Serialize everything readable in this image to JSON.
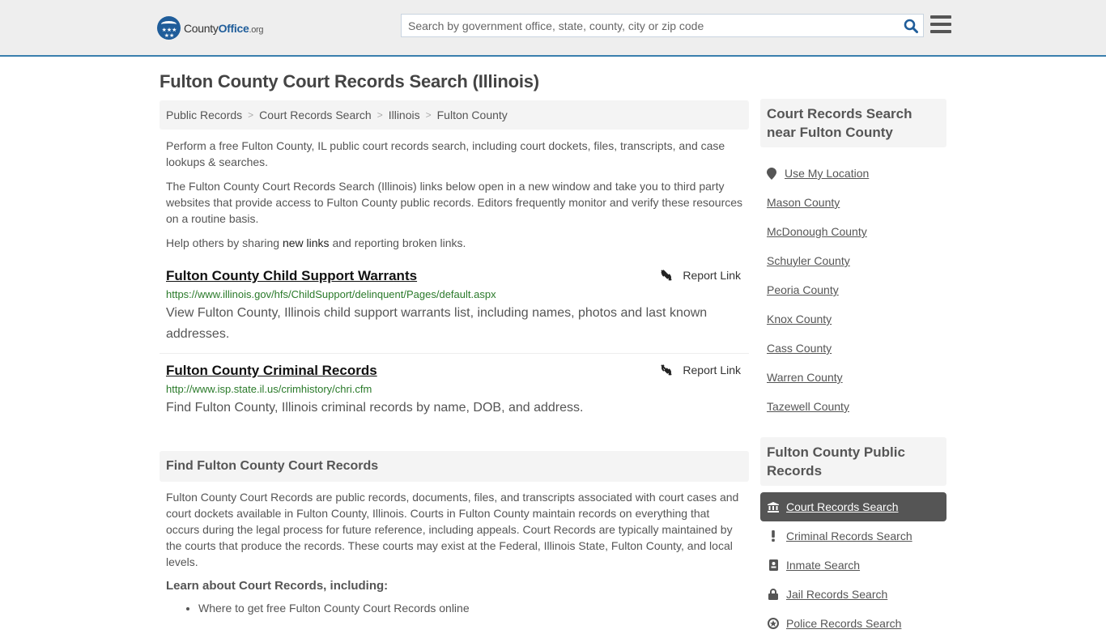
{
  "header": {
    "logo": {
      "name_part1": "County",
      "name_part2": "Office",
      "tld": ".org"
    },
    "search": {
      "placeholder": "Search by government office, state, county, city or zip code",
      "value": ""
    },
    "colors": {
      "brand": "#1f5d9a",
      "topbar_border": "#3a7fad"
    }
  },
  "page": {
    "title": "Fulton County Court Records Search (Illinois)"
  },
  "breadcrumb": [
    {
      "label": "Public Records"
    },
    {
      "label": "Court Records Search"
    },
    {
      "label": "Illinois"
    },
    {
      "label": "Fulton County"
    }
  ],
  "intro": {
    "p1": "Perform a free Fulton County, IL public court records search, including court dockets, files, transcripts, and case lookups & searches.",
    "p2": "The Fulton County Court Records Search (Illinois) links below open in a new window and take you to third party websites that provide access to Fulton County public records. Editors frequently monitor and verify these resources on a routine basis.",
    "p3_before": "Help others by sharing ",
    "p3_link": "new links",
    "p3_after": " and reporting broken links."
  },
  "links": [
    {
      "title": "Fulton County Child Support Warrants",
      "url": "https://www.illinois.gov/hfs/ChildSupport/delinquent/Pages/default.aspx",
      "description": "View Fulton County, Illinois child support warrants list, including names, photos and last known addresses.",
      "report_label": "Report Link"
    },
    {
      "title": "Fulton County Criminal Records",
      "url": "http://www.isp.state.il.us/crimhistory/chri.cfm",
      "description": "Find Fulton County, Illinois criminal records by name, DOB, and address.",
      "report_label": "Report Link"
    }
  ],
  "find_section": {
    "heading": "Find Fulton County Court Records",
    "body": "Fulton County Court Records are public records, documents, files, and transcripts associated with court cases and court dockets available in Fulton County, Illinois. Courts in Fulton County maintain records on everything that occurs during the legal process for future reference, including appeals. Court Records are typically maintained by the courts that produce the records. These courts may exist at the Federal, Illinois State, Fulton County, and local levels.",
    "learn_heading": "Learn about Court Records, including:",
    "learn_items": [
      "Where to get free Fulton County Court Records online"
    ]
  },
  "sidebar": {
    "near_heading": "Court Records Search near Fulton County",
    "use_location": "Use My Location",
    "near_items": [
      "Mason County",
      "McDonough County",
      "Schuyler County",
      "Peoria County",
      "Knox County",
      "Cass County",
      "Warren County",
      "Tazewell County"
    ],
    "public_heading": "Fulton County Public Records",
    "public_items": [
      {
        "label": "Court Records Search",
        "icon": "courthouse-icon",
        "active": true
      },
      {
        "label": "Criminal Records Search",
        "icon": "exclamation-icon",
        "active": false
      },
      {
        "label": "Inmate Search",
        "icon": "id-badge-icon",
        "active": false
      },
      {
        "label": "Jail Records Search",
        "icon": "lock-icon",
        "active": false
      },
      {
        "label": "Police Records Search",
        "icon": "police-badge-icon",
        "active": false
      }
    ]
  }
}
